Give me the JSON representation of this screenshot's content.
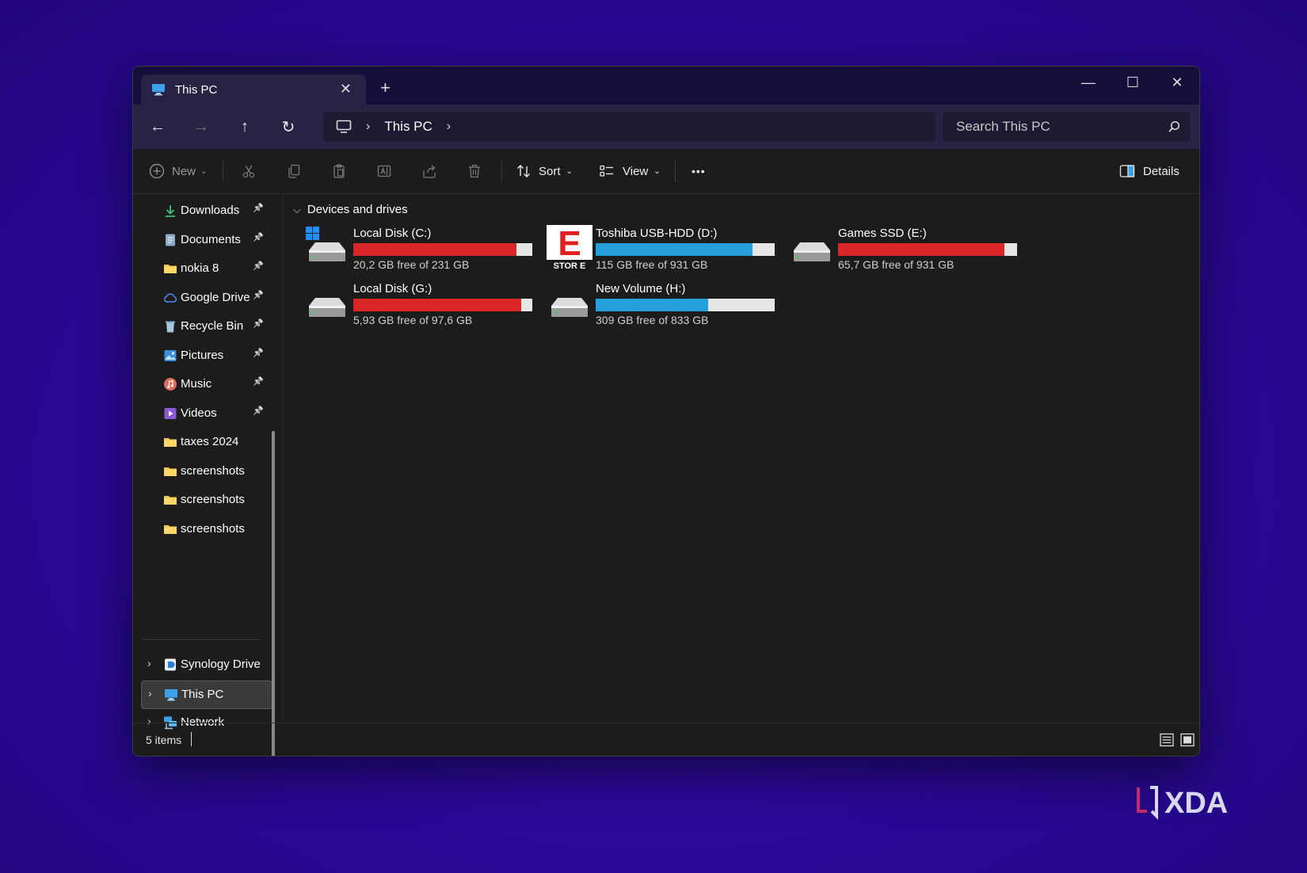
{
  "window": {
    "tab_title": "This PC",
    "tab_close": "✕",
    "new_tab": "+",
    "controls": {
      "minimize": "—",
      "maximize": "☐",
      "close": "✕"
    }
  },
  "navigation": {
    "back": "←",
    "forward": "→",
    "up": "↑",
    "refresh": "↻",
    "address": {
      "location": "This PC",
      "sep": "›"
    },
    "search": {
      "placeholder": "Search This PC"
    }
  },
  "toolbar": {
    "new_label": "New",
    "sort_label": "Sort",
    "view_label": "View",
    "more_label": "•••",
    "details_label": "Details"
  },
  "sidebar": {
    "quick_access": [
      {
        "label": "Downloads",
        "icon": "downloads-icon",
        "pinned": true
      },
      {
        "label": "Documents",
        "icon": "documents-icon",
        "pinned": true
      },
      {
        "label": "nokia 8",
        "icon": "folder-icon",
        "pinned": true
      },
      {
        "label": "Google Drive",
        "icon": "google-drive-icon",
        "pinned": true
      },
      {
        "label": "Recycle Bin",
        "icon": "recycle-bin-icon",
        "pinned": true
      },
      {
        "label": "Pictures",
        "icon": "pictures-icon",
        "pinned": true
      },
      {
        "label": "Music",
        "icon": "music-icon",
        "pinned": true
      },
      {
        "label": "Videos",
        "icon": "videos-icon",
        "pinned": true
      },
      {
        "label": "taxes 2024",
        "icon": "folder-icon",
        "pinned": false
      },
      {
        "label": "screenshots",
        "icon": "folder-icon",
        "pinned": false
      },
      {
        "label": "screenshots",
        "icon": "folder-icon",
        "pinned": false
      },
      {
        "label": "screenshots",
        "icon": "folder-icon",
        "pinned": false
      }
    ],
    "locations": [
      {
        "label": "Synology Drive",
        "icon": "synology-drive-icon",
        "selected": false
      },
      {
        "label": "This PC",
        "icon": "this-pc-icon",
        "selected": true
      },
      {
        "label": "Network",
        "icon": "network-icon",
        "selected": false
      }
    ],
    "pin_glyph": "📌",
    "expand_glyph": "›"
  },
  "content": {
    "group_title": "Devices and drives",
    "group_chevron": "⌵",
    "drives": [
      {
        "name": "Local Disk (C:)",
        "free_text": "20,2 GB free of 231 GB",
        "used_fraction": 0.913,
        "bar_color": "#da2626",
        "icon": "windows-drive-icon"
      },
      {
        "name": "Toshiba USB-HDD (D:)",
        "free_text": "115 GB free of 931 GB",
        "used_fraction": 0.876,
        "bar_color": "#26a0da",
        "icon": "store-e-drive-icon"
      },
      {
        "name": "Games SSD (E:)",
        "free_text": "65,7 GB free of 931 GB",
        "used_fraction": 0.929,
        "bar_color": "#da2626",
        "icon": "drive-icon"
      },
      {
        "name": "Local Disk (G:)",
        "free_text": "5,93 GB free of 97,6 GB",
        "used_fraction": 0.939,
        "bar_color": "#da2626",
        "icon": "drive-icon"
      },
      {
        "name": "New Volume (H:)",
        "free_text": "309 GB free of 833 GB",
        "used_fraction": 0.629,
        "bar_color": "#26a0da",
        "icon": "drive-icon"
      }
    ]
  },
  "status": {
    "items_text": "5 items"
  },
  "store_e_logo": {
    "letter": "E",
    "caption": "STOR E"
  },
  "watermark": "XDA"
}
